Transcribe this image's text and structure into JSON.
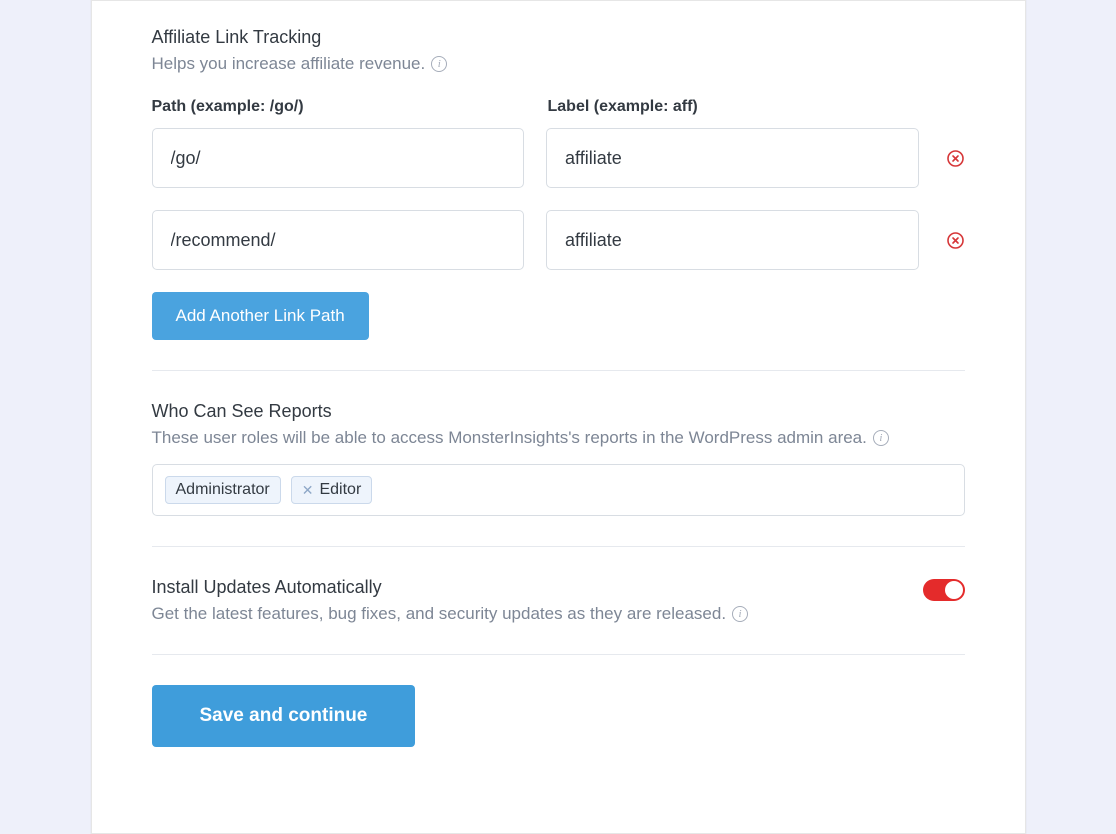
{
  "affiliate": {
    "title": "Affiliate Link Tracking",
    "desc": "Helps you increase affiliate revenue.",
    "path_header": "Path (example: /go/)",
    "label_header": "Label (example: aff)",
    "rows": [
      {
        "path": "/go/",
        "label": "affiliate"
      },
      {
        "path": "/recommend/",
        "label": "affiliate"
      }
    ],
    "add_button": "Add Another Link Path"
  },
  "reports": {
    "title": "Who Can See Reports",
    "desc": "These user roles will be able to access MonsterInsights's reports in the WordPress admin area.",
    "tags": [
      {
        "label": "Administrator",
        "removable": false
      },
      {
        "label": "Editor",
        "removable": true
      }
    ]
  },
  "updates": {
    "title": "Install Updates Automatically",
    "desc": "Get the latest features, bug fixes, and security updates as they are released.",
    "enabled": true
  },
  "save_button": "Save and continue"
}
